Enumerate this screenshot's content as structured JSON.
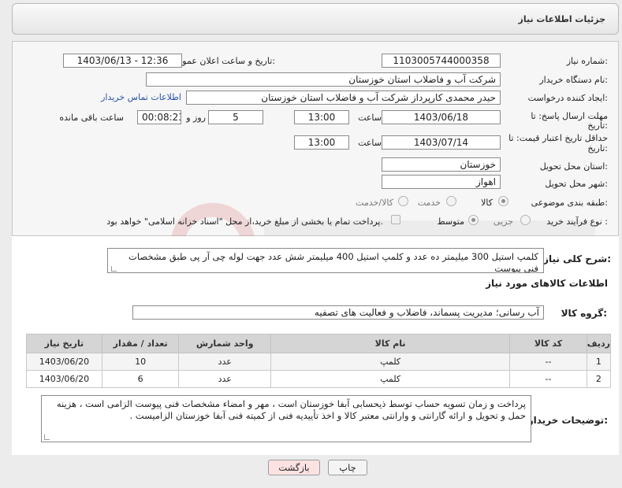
{
  "header": {
    "title": "جزئیات اطلاعات نیاز"
  },
  "form": {
    "need_number": {
      "label": "شماره نیاز:",
      "value": "1103005744000358"
    },
    "announce_datetime": {
      "label": "تاریخ و ساعت اعلان عمومی:",
      "value": "1403/06/13 - 12:36"
    },
    "buyer_org": {
      "label": "نام دستگاه خریدار:",
      "value": "شرکت آب و فاضلاب استان خوزستان"
    },
    "requester": {
      "label": "ایجاد کننده درخواست:",
      "value": "حیدر محمدی کارپرداز شرکت آب و فاضلاب استان خوزستان",
      "contact_link": "اطلاعات تماس خریدار"
    },
    "reply_deadline": {
      "label1": "مهلت ارسال پاسخ: تا",
      "label2": "تاریخ:",
      "date": "1403/06/18",
      "time_label": "ساعت",
      "time": "13:00",
      "days": "5",
      "days_label": "روز و",
      "remaining": "00:08:23",
      "remaining_label": "ساعت باقی مانده"
    },
    "price_validity": {
      "label1": "حداقل تاریخ اعتبار قیمت: تا",
      "label2": "تاریخ:",
      "date": "1403/07/14",
      "time_label": "ساعت",
      "time": "13:00"
    },
    "delivery_province": {
      "label": "استان محل تحویل:",
      "value": "خوزستان"
    },
    "delivery_city": {
      "label": "شهر محل تحویل:",
      "value": "اهواز"
    },
    "category": {
      "label": "طبقه بندی موضوعی:",
      "options": [
        "کالا",
        "خدمت",
        "کالا/خدمت"
      ]
    },
    "purchase_type": {
      "label": "نوع فرآیند خرید :",
      "options": [
        "جزیی",
        "متوسط"
      ],
      "payment_note": "پرداخت تمام یا بخشی از مبلغ خرید،از محل \"اسناد خزانه اسلامی\" خواهد بود."
    }
  },
  "need_description": {
    "label": "شرح کلی نیاز:",
    "value": "کلمپ استیل 300 میلیمتر ده عدد و کلمپ استیل 400 میلیمتر شش عدد  جهت لوله چی آر پی طبق مشخصات فنی پیوست"
  },
  "goods_info": {
    "title": "اطلاعات کالاهای مورد نیاز",
    "group_label": "گروه کالا:",
    "group_value": "آب رسانی؛ مدیریت پسماند، فاضلاب و فعالیت های تصفیه"
  },
  "table": {
    "headers": [
      "ردیف",
      "کد کالا",
      "نام کالا",
      "واحد شمارش",
      "تعداد / مقدار",
      "تاریخ نیاز"
    ],
    "rows": [
      [
        "1",
        "--",
        "کلمپ",
        "عدد",
        "10",
        "1403/06/20"
      ],
      [
        "2",
        "--",
        "کلمپ",
        "عدد",
        "6",
        "1403/06/20"
      ]
    ]
  },
  "buyer_notes": {
    "label": "توضیحات خریدار:",
    "value": "پرداخت و زمان تسویه حساب توسط ذیحسابی آبفا خوزستان است ، مهر و امضاء مشخصات فنی پیوست الزامی است ، هزینه حمل و تحویل و ارائه گارانتی و وارانتی معتبر کالا و اخذ تأییدیه فنی از کمیته فنی آبفا خوزستان الزامیست ."
  },
  "buttons": {
    "print": "چاپ",
    "back": "بازگشت"
  },
  "colors": {
    "link": "#2a53a8",
    "back_button_bg": "#fde2e2",
    "header_bg": "#e6e6e6",
    "table_header_bg": "#d5d5d5"
  }
}
